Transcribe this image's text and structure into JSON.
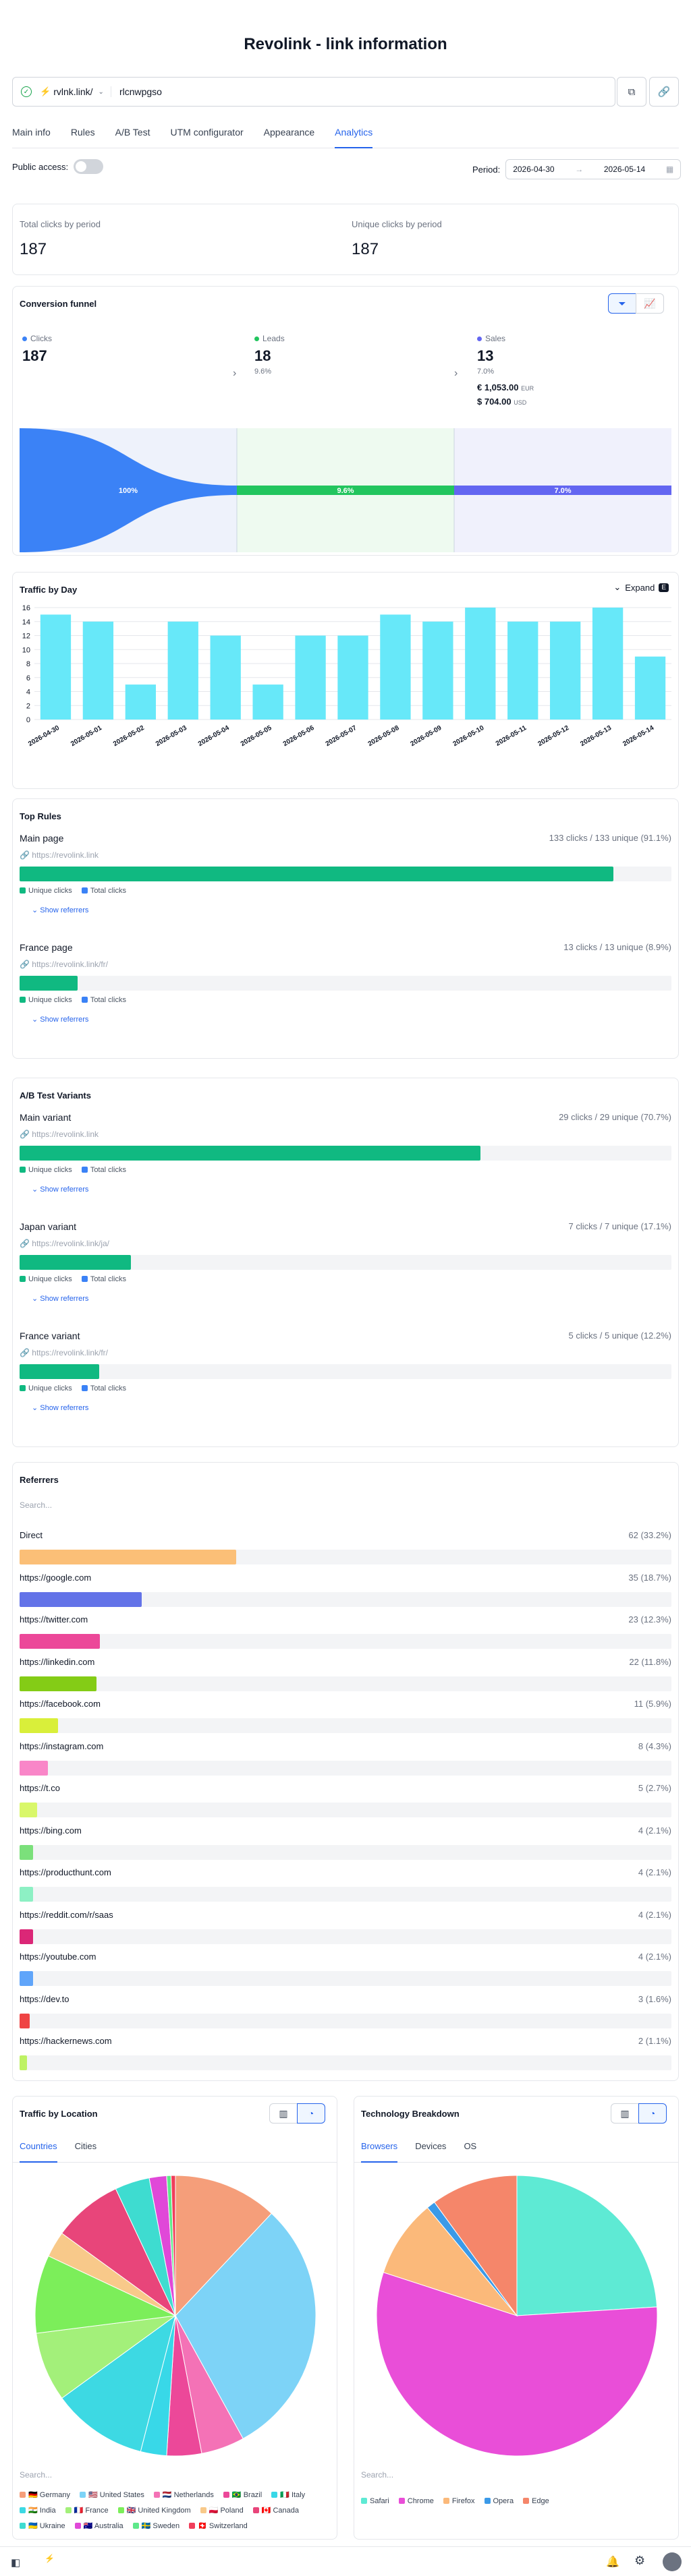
{
  "page": {
    "title": "Revolink - link information"
  },
  "link": {
    "domain": "rvlnk.link/",
    "slug": "rlcnwpgso"
  },
  "tabs": [
    {
      "label": "Main info",
      "active": false
    },
    {
      "label": "Rules",
      "active": false
    },
    {
      "label": "A/B Test",
      "active": false
    },
    {
      "label": "UTM configurator",
      "active": false
    },
    {
      "label": "Appearance",
      "active": false
    },
    {
      "label": "Analytics",
      "active": true
    }
  ],
  "public_access": {
    "label": "Public access:",
    "enabled": false
  },
  "period": {
    "label": "Period:",
    "from": "2026-04-30",
    "to": "2026-05-14",
    "separator": "→"
  },
  "totals": {
    "total_label": "Total clicks by period",
    "total_value": "187",
    "unique_label": "Unique clicks by period",
    "unique_value": "187"
  },
  "funnel": {
    "title": "Conversion funnel",
    "steps": [
      {
        "label": "Clicks",
        "value": "187",
        "pct": "",
        "color": "#3b82f6"
      },
      {
        "label": "Leads",
        "value": "18",
        "pct": "9.6%",
        "color": "#22c55e"
      },
      {
        "label": "Sales",
        "value": "13",
        "pct": "7.0%",
        "color": "#6366f1"
      }
    ],
    "money": [
      {
        "amount": "€ 1,053.00",
        "currency": "EUR"
      },
      {
        "amount": "$ 704.00",
        "currency": "USD"
      }
    ],
    "bars": [
      {
        "label": "100%",
        "fraction": 1.0
      },
      {
        "label": "9.6%",
        "fraction": 0.096
      },
      {
        "label": "7.0%",
        "fraction": 0.07
      }
    ]
  },
  "traffic_day": {
    "title": "Traffic by Day",
    "expand_label": "Expand",
    "expand_key": "E",
    "chart_data": {
      "type": "bar",
      "categories": [
        "2026-04-30",
        "2026-05-01",
        "2026-05-02",
        "2026-05-03",
        "2026-05-04",
        "2026-05-05",
        "2026-05-06",
        "2026-05-07",
        "2026-05-08",
        "2026-05-09",
        "2026-05-10",
        "2026-05-11",
        "2026-05-12",
        "2026-05-13",
        "2026-05-14"
      ],
      "values": [
        15,
        14,
        5,
        14,
        12,
        5,
        12,
        12,
        15,
        14,
        16,
        14,
        14,
        16,
        9
      ],
      "yticks": [
        "0",
        "2",
        "4",
        "6",
        "8",
        "10",
        "12",
        "14",
        "16"
      ],
      "ylim": [
        0,
        16
      ],
      "color": "#67e8f9"
    }
  },
  "top_rules": {
    "title": "Top Rules",
    "unique_label": "Unique clicks",
    "total_label": "Total clicks",
    "show_referrers": "Show referrers",
    "items": [
      {
        "name": "Main page",
        "url": "https://revolink.link",
        "stats": "133 clicks / 133 unique (91.1%)",
        "fraction": 0.911
      },
      {
        "name": "France page",
        "url": "https://revolink.link/fr/",
        "stats": "13 clicks / 13 unique (8.9%)",
        "fraction": 0.089
      }
    ]
  },
  "ab_test": {
    "title": "A/B Test Variants",
    "unique_label": "Unique clicks",
    "total_label": "Total clicks",
    "show_referrers": "Show referrers",
    "items": [
      {
        "name": "Main variant",
        "url": "https://revolink.link",
        "stats": "29 clicks / 29 unique (70.7%)",
        "fraction": 0.707
      },
      {
        "name": "Japan variant",
        "url": "https://revolink.link/ja/",
        "stats": "7 clicks / 7 unique (17.1%)",
        "fraction": 0.171
      },
      {
        "name": "France variant",
        "url": "https://revolink.link/fr/",
        "stats": "5 clicks / 5 unique (12.2%)",
        "fraction": 0.122
      }
    ]
  },
  "referrers": {
    "title": "Referrers",
    "search_placeholder": "Search...",
    "items": [
      {
        "name": "Direct",
        "stats": "62 (33.2%)",
        "fraction": 0.332,
        "color": "#fbbf77"
      },
      {
        "name": "https://google.com",
        "stats": "35 (18.7%)",
        "fraction": 0.187,
        "color": "#6373e8"
      },
      {
        "name": "https://twitter.com",
        "stats": "23 (12.3%)",
        "fraction": 0.123,
        "color": "#ec4899"
      },
      {
        "name": "https://linkedin.com",
        "stats": "22 (11.8%)",
        "fraction": 0.118,
        "color": "#84cc16"
      },
      {
        "name": "https://facebook.com",
        "stats": "11 (5.9%)",
        "fraction": 0.059,
        "color": "#d9ef3a"
      },
      {
        "name": "https://instagram.com",
        "stats": "8 (4.3%)",
        "fraction": 0.043,
        "color": "#f986c8"
      },
      {
        "name": "https://t.co",
        "stats": "5 (2.7%)",
        "fraction": 0.027,
        "color": "#d9f76a"
      },
      {
        "name": "https://bing.com",
        "stats": "4 (2.1%)",
        "fraction": 0.021,
        "color": "#7be07b"
      },
      {
        "name": "https://producthunt.com",
        "stats": "4 (2.1%)",
        "fraction": 0.021,
        "color": "#8df0c4"
      },
      {
        "name": "https://reddit.com/r/saas",
        "stats": "4 (2.1%)",
        "fraction": 0.021,
        "color": "#db2777"
      },
      {
        "name": "https://youtube.com",
        "stats": "4 (2.1%)",
        "fraction": 0.021,
        "color": "#60a5fa"
      },
      {
        "name": "https://dev.to",
        "stats": "3 (1.6%)",
        "fraction": 0.016,
        "color": "#ef4444"
      },
      {
        "name": "https://hackernews.com",
        "stats": "2 (1.1%)",
        "fraction": 0.011,
        "color": "#bef264"
      }
    ]
  },
  "location": {
    "title": "Traffic by Location",
    "tabs": [
      {
        "label": "Countries",
        "active": true
      },
      {
        "label": "Cities",
        "active": false
      }
    ],
    "search_placeholder": "Search...",
    "chart_data": {
      "type": "pie",
      "slices": [
        {
          "name": "Germany",
          "flag": "🇩🇪",
          "value": 12.0,
          "color": "#f59e7a"
        },
        {
          "name": "United States",
          "flag": "🇺🇸",
          "value": 30.0,
          "color": "#7dd3f7"
        },
        {
          "name": "Netherlands",
          "flag": "🇳🇱",
          "value": 5.0,
          "color": "#f472b6"
        },
        {
          "name": "Brazil",
          "flag": "🇧🇷",
          "value": 4.0,
          "color": "#ec4899"
        },
        {
          "name": "Italy",
          "flag": "🇮🇹",
          "value": 3.0,
          "color": "#38d8e8"
        },
        {
          "name": "India",
          "flag": "🇮🇳",
          "value": 11.0,
          "color": "#3dd9e3"
        },
        {
          "name": "France",
          "flag": "🇫🇷",
          "value": 8.0,
          "color": "#a3f07a"
        },
        {
          "name": "United Kingdom",
          "flag": "🇬🇧",
          "value": 9.0,
          "color": "#7cee5a"
        },
        {
          "name": "Poland",
          "flag": "🇵🇱",
          "value": 3.0,
          "color": "#f8c98a"
        },
        {
          "name": "Canada",
          "flag": "🇨🇦",
          "value": 8.0,
          "color": "#e8457a"
        },
        {
          "name": "Ukraine",
          "flag": "🇺🇦",
          "value": 4.0,
          "color": "#3edcd0"
        },
        {
          "name": "Australia",
          "flag": "🇦🇺",
          "value": 2.0,
          "color": "#e048d8"
        },
        {
          "name": "Sweden",
          "flag": "🇸🇪",
          "value": 0.5,
          "color": "#5ee88a"
        },
        {
          "name": "Switzerland",
          "flag": "🇨🇭",
          "value": 0.5,
          "color": "#f03e5a"
        }
      ]
    }
  },
  "technology": {
    "title": "Technology Breakdown",
    "tabs": [
      {
        "label": "Browsers",
        "active": true
      },
      {
        "label": "Devices",
        "active": false
      },
      {
        "label": "OS",
        "active": false
      }
    ],
    "search_placeholder": "Search...",
    "chart_data": {
      "type": "pie",
      "slices": [
        {
          "name": "Safari",
          "value": 24.0,
          "color": "#5eead4"
        },
        {
          "name": "Chrome",
          "value": 56.0,
          "color": "#e94ed8"
        },
        {
          "name": "Firefox",
          "value": 9.0,
          "color": "#fbb97a"
        },
        {
          "name": "Opera",
          "value": 1.0,
          "color": "#3b9ae8"
        },
        {
          "name": "Edge",
          "value": 10.0,
          "color": "#f5866a"
        }
      ]
    }
  },
  "colors": {
    "accent": "#2563eb",
    "unique": "#10b981",
    "total": "#3b82f6"
  }
}
